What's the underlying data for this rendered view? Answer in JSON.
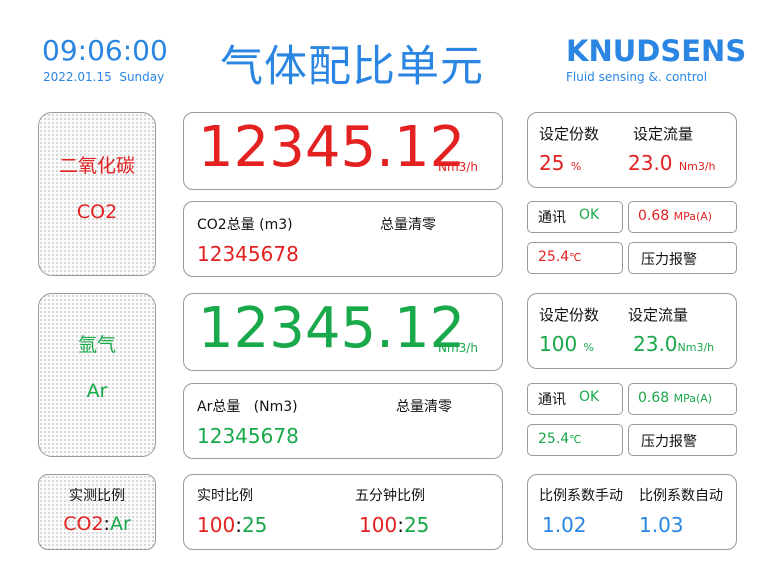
{
  "header": {
    "time": "09:06:00",
    "date": "2022.01.15  Sunday",
    "title": "气体配比单元",
    "brand": "KNUDSENS",
    "tagline": "Fluid sensing &. control"
  },
  "co2": {
    "name_cn": "二氧化碳",
    "name_en": "CO2",
    "flow_value": "12345.12",
    "flow_unit": "Nm3/h",
    "total_label": "CO2总量 (m3)",
    "total_reset": "总量清零",
    "total_value": "12345678",
    "set_share_label": "设定份数",
    "set_share_value": "25",
    "set_share_unit": "%",
    "set_flow_label": "设定流量",
    "set_flow_value": "23.0",
    "set_flow_unit": "Nm3/h",
    "comm_label": "通讯",
    "comm_status": "OK",
    "pressure_value": "0.68",
    "pressure_unit": "MPa(A)",
    "temp_value": "25.4",
    "temp_unit": "℃",
    "alarm_label": "压力报警"
  },
  "ar": {
    "name_cn": "氩气",
    "name_en": "Ar",
    "flow_value": "12345.12",
    "flow_unit": "Nm3/h",
    "total_label": "Ar总量   (Nm3)",
    "total_reset": "总量清零",
    "total_value": "12345678",
    "set_share_label": "设定份数",
    "set_share_value": "100",
    "set_share_unit": "%",
    "set_flow_label": "设定流量",
    "set_flow_value": "23.0",
    "set_flow_unit": "Nm3/h",
    "comm_label": "通讯",
    "comm_status": "OK",
    "pressure_value": "0.68",
    "pressure_unit": "MPa(A)",
    "temp_value": "25.4",
    "temp_unit": "℃",
    "alarm_label": "压力报警"
  },
  "ratio": {
    "title": "实测比例",
    "left": "CO2",
    "sep": ":",
    "right": "Ar",
    "realtime_label": "实时比例",
    "realtime_a": "100",
    "realtime_b": "25",
    "fivemin_label": "五分钟比例",
    "fivemin_a": "100",
    "fivemin_b": "25",
    "coef_manual_label": "比例系数手动",
    "coef_auto_label": "比例系数自动",
    "coef_manual_value": "1.02",
    "coef_auto_value": "1.03"
  },
  "colors": {
    "accent_blue": "#2a86e2",
    "co2_red": "#e32121",
    "ar_green": "#19a84a"
  }
}
